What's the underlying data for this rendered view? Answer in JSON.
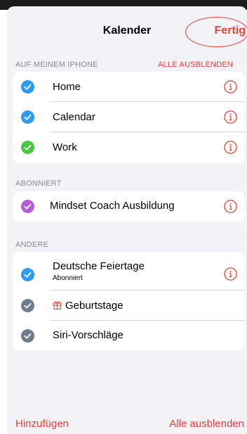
{
  "header": {
    "title": "Kalender",
    "done_label": "Fertig"
  },
  "sections": {
    "on_iphone": {
      "label": "AUF MEINEM IPHONE",
      "action": "ALLE AUSBLENDEN",
      "items": [
        {
          "label": "Home",
          "color": "#2e9bef"
        },
        {
          "label": "Calendar",
          "color": "#2e9bef"
        },
        {
          "label": "Work",
          "color": "#4cc641"
        }
      ]
    },
    "subscribed": {
      "label": "ABONNIERT",
      "items": [
        {
          "label": "Mindset Coach Ausbildung",
          "color": "#b55ed7"
        }
      ]
    },
    "other": {
      "label": "ANDERE",
      "items": [
        {
          "label": "Deutsche Feiertage",
          "sub": "Abonniert",
          "color": "#2e9bef"
        },
        {
          "label": "Geburtstage",
          "color": "#6e7b8f",
          "icon": "gift-icon"
        },
        {
          "label": "Siri-Vorschläge",
          "color": "#6e7b8f"
        }
      ]
    }
  },
  "footer": {
    "add_label": "Hinzufügen",
    "hide_all_label": "Alle ausblenden"
  },
  "colors": {
    "accent": "#e8413b",
    "background": "#f2f2f7"
  }
}
